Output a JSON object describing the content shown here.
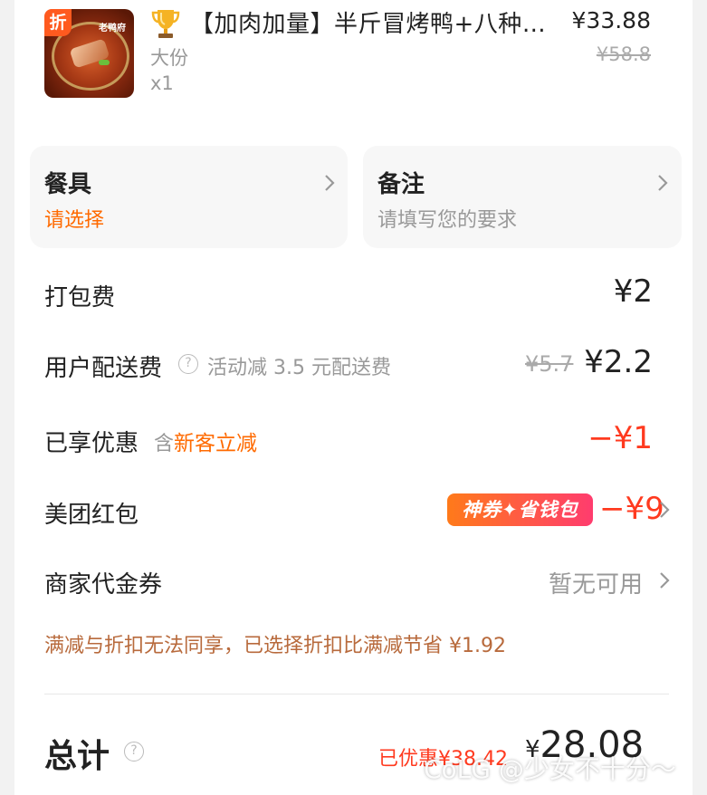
{
  "product": {
    "discount_tag": "折",
    "thumb_logo": "老鸭府",
    "name": "【加肉加量】半斤冒烤鸭+八种…",
    "price": "¥33.88",
    "original_price": "¥58.8",
    "spec": "大份",
    "qty": "x1"
  },
  "options": {
    "tableware": {
      "title": "餐具",
      "subtitle": "请选择"
    },
    "remark": {
      "title": "备注",
      "subtitle": "请填写您的要求"
    }
  },
  "rows": {
    "packing_fee": {
      "label": "打包费",
      "value": "¥2"
    },
    "delivery_fee": {
      "label": "用户配送费",
      "note": "活动减 3.5 元配送费",
      "original": "¥5.7",
      "value": "¥2.2"
    },
    "discount": {
      "label": "已享优惠",
      "prefix": "含",
      "promo": "新客立减",
      "value": "−¥1"
    },
    "red_packet": {
      "label": "美团红包",
      "badge": "神券✦省钱包",
      "value": "−¥9"
    },
    "merchant_voucher": {
      "label": "商家代金券",
      "value": "暂无可用"
    }
  },
  "notice": "满减与折扣无法同享，已选择折扣比满减节省 ¥1.92",
  "total": {
    "label": "总计",
    "saved": "已优惠¥38.42",
    "yen": "¥",
    "value": "28.08"
  },
  "watermark": "CoLG @少女不十分～",
  "colors": {
    "accent": "#ff3a1f",
    "orange": "#ff6a00",
    "notice": "#b86a3c"
  }
}
